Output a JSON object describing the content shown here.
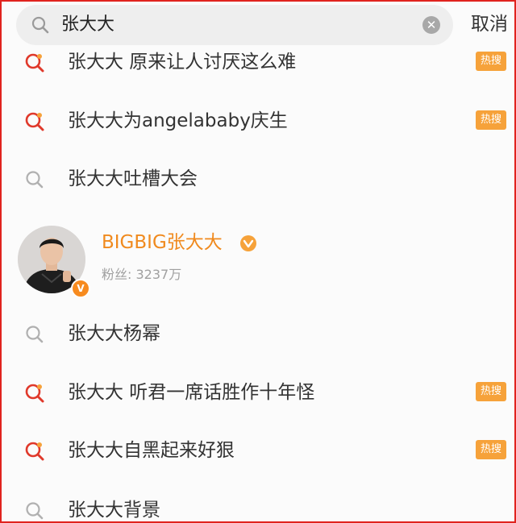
{
  "search": {
    "value": "张大大",
    "cancel_label": "取消"
  },
  "colors": {
    "accent": "#f08a1e",
    "hot_badge": "#f6a23a",
    "frame_border": "#e0231e"
  },
  "suggestions_top": [
    {
      "label": "张大大 原来让人讨厌这么难",
      "hot": true,
      "badge": "热搜",
      "icon": "hot-search-icon"
    },
    {
      "label": "张大大为angelababy庆生",
      "hot": true,
      "badge": "热搜",
      "icon": "hot-search-icon"
    },
    {
      "label": "张大大吐槽大会",
      "hot": false,
      "icon": "search-icon"
    }
  ],
  "user": {
    "name": "BIGBIG张大大",
    "followers": "粉丝: 3237万",
    "verified_icon": "verified-v-badge",
    "vip_icon": "vip-crown-icon"
  },
  "suggestions_bottom": [
    {
      "label": "张大大杨幂",
      "hot": false,
      "icon": "search-icon"
    },
    {
      "label": "张大大 听君一席话胜作十年怪",
      "hot": true,
      "badge": "热搜",
      "icon": "hot-search-icon"
    },
    {
      "label": "张大大自黑起来好狠",
      "hot": true,
      "badge": "热搜",
      "icon": "hot-search-icon"
    },
    {
      "label": "张大大背景",
      "hot": false,
      "icon": "search-icon"
    }
  ]
}
